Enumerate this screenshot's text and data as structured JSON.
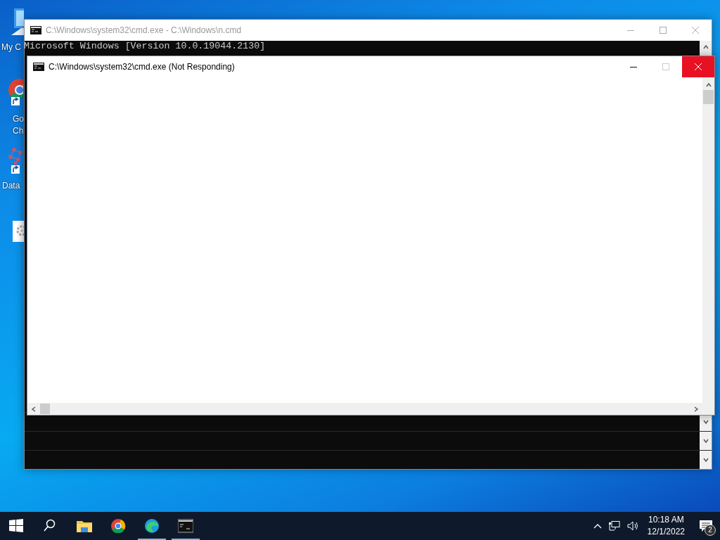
{
  "desktop_icons": [
    {
      "kind": "computer",
      "shortcut": false,
      "lines": [
        "My C"
      ]
    },
    {
      "kind": "chrome",
      "shortcut": true,
      "lines": [
        "Go",
        "Ch"
      ]
    },
    {
      "kind": "app",
      "shortcut": true,
      "lines": [
        "Data"
      ]
    },
    {
      "kind": "settings",
      "shortcut": false
    }
  ],
  "windows": [
    {
      "title": "C:\\Windows\\system32\\cmd.exe - C:\\Windows\\n.cmd",
      "active": false,
      "maximize_disabled": false,
      "lines": [
        "Microsoft Windows [Version 10.0.19044.2130]"
      ],
      "stale_rows": [
        {
          "kind": "scroll-row"
        },
        {
          "kind": "scroll-row"
        },
        {
          "kind": "scroll-row"
        }
      ]
    },
    {
      "title": "C:\\Windows\\system32\\cmd.exe (Not Responding)",
      "active": true,
      "maximize_disabled": true
    }
  ],
  "taskbar": {
    "apps": [
      {
        "kind": "start",
        "running": false
      },
      {
        "kind": "search",
        "running": false
      },
      {
        "kind": "explorer",
        "running": false
      },
      {
        "kind": "chrome",
        "running": false
      },
      {
        "kind": "edge",
        "running": true
      },
      {
        "kind": "cmd",
        "running": true
      }
    ],
    "tray": {
      "time": "10:18 AM",
      "date": "12/1/2022",
      "notification_count": "2"
    }
  }
}
